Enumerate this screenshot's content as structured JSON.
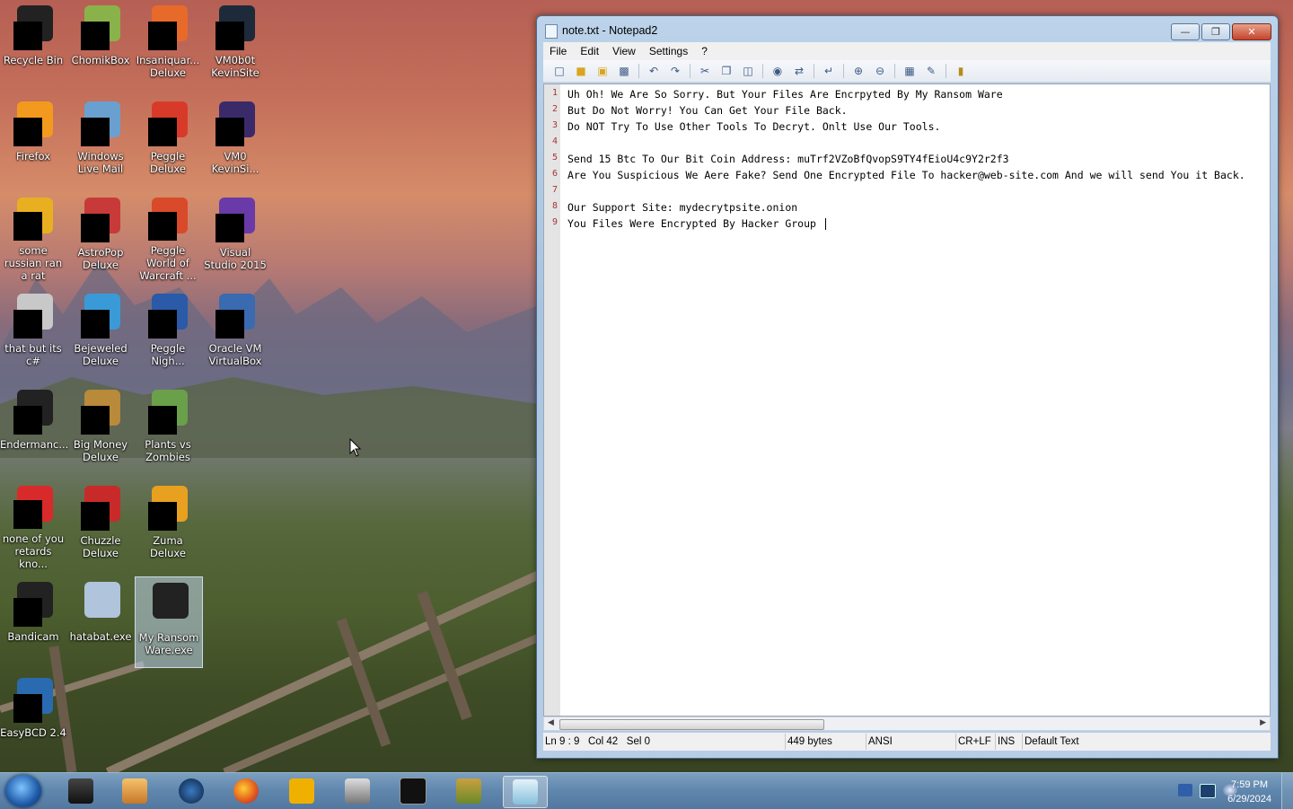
{
  "desktop": {
    "icons": [
      {
        "label": "Recycle Bin"
      },
      {
        "label": "ChomikBox"
      },
      {
        "label": "Insaniquar... Deluxe"
      },
      {
        "label": "VM0b0t KevinSite"
      },
      {
        "label": "Firefox"
      },
      {
        "label": "Windows Live Mail"
      },
      {
        "label": "Peggle Deluxe"
      },
      {
        "label": "VM0 KevinSi..."
      },
      {
        "label": "some russian ran a rat"
      },
      {
        "label": "AstroPop Deluxe"
      },
      {
        "label": "Peggle World of Warcraft ..."
      },
      {
        "label": "Visual Studio 2015"
      },
      {
        "label": "that but its c#"
      },
      {
        "label": "Bejeweled Deluxe"
      },
      {
        "label": "Peggle Nigh..."
      },
      {
        "label": "Oracle VM VirtualBox"
      },
      {
        "label": "Endermanc..."
      },
      {
        "label": "Big Money Deluxe"
      },
      {
        "label": "Plants vs Zombies"
      },
      {
        "label": "none of you retards kno..."
      },
      {
        "label": "Chuzzle Deluxe"
      },
      {
        "label": "Zuma Deluxe"
      },
      {
        "label": "Bandicam"
      },
      {
        "label": "hatabat.exe"
      },
      {
        "label": "My Ransom Ware.exe"
      },
      {
        "label": "EasyBCD 2.4"
      }
    ]
  },
  "window": {
    "title": "note.txt - Notepad2",
    "menu": [
      "File",
      "Edit",
      "View",
      "Settings",
      "?"
    ],
    "lines": [
      {
        "n": "1",
        "text": "Uh Oh! We Are So Sorry. But Your Files Are Encrpyted By My Ransom Ware"
      },
      {
        "n": "2",
        "text": "But Do Not Worry! You Can Get Your File Back."
      },
      {
        "n": "3",
        "text": "Do NOT Try To Use Other Tools To Decryt. Onlt Use Our Tools."
      },
      {
        "n": "4",
        "text": ""
      },
      {
        "n": "5",
        "text": "Send 15 Btc To Our Bit Coin Address: muTrf2VZoBfQvopS9TY4fEioU4c9Y2r2f3"
      },
      {
        "n": "6",
        "text": "Are You Suspicious We Aere Fake? Send One Encrypted File To hacker@web-site.com And we will send You it Back."
      },
      {
        "n": "7",
        "text": ""
      },
      {
        "n": "8",
        "text": "Our Support Site: mydecrytpsite.onion"
      },
      {
        "n": "9",
        "text": "You Files Were Encrypted By Hacker Group "
      }
    ],
    "status": {
      "pos": "Ln 9 : 9   Col 42   Sel 0",
      "size": "449 bytes",
      "encoding": "ANSI",
      "eol": "CR+LF",
      "mode": "INS",
      "scheme": "Default Text"
    }
  },
  "taskbar": {
    "clock_time": "7:59 PM",
    "clock_date": "6/29/2024"
  }
}
